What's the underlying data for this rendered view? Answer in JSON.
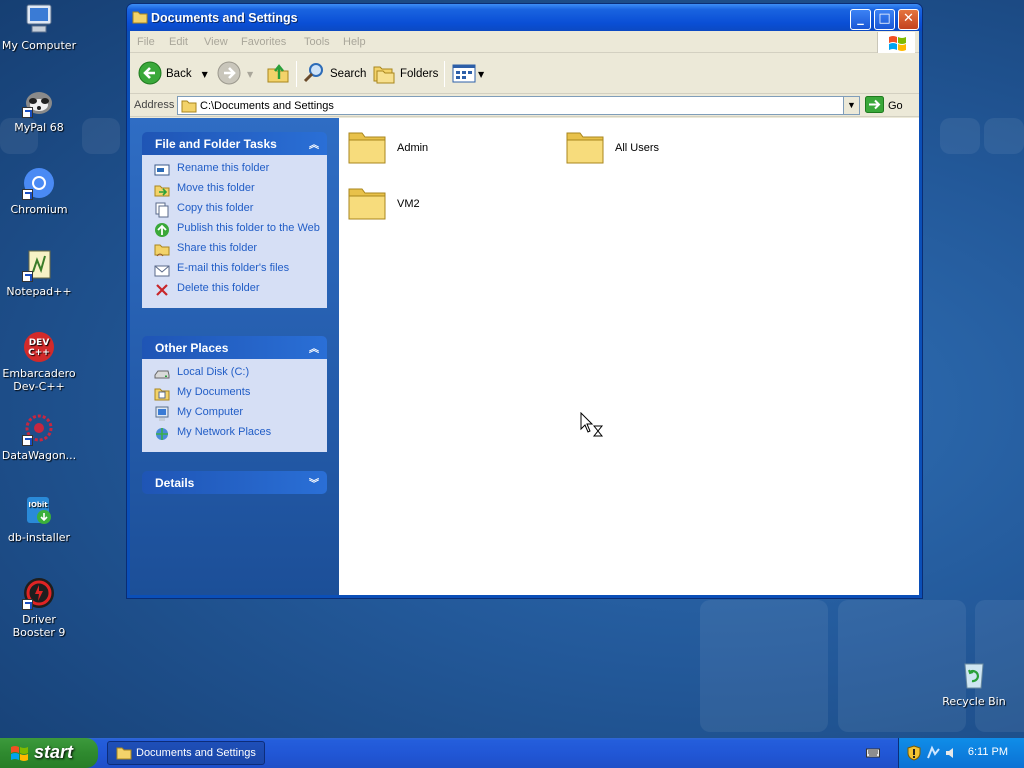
{
  "desktop": {
    "icons": [
      {
        "label": "My Computer",
        "icon": "my-computer-icon"
      },
      {
        "label": "MyPal 68",
        "icon": "mypal-icon"
      },
      {
        "label": "Chromium",
        "icon": "chromium-icon"
      },
      {
        "label": "Notepad++",
        "icon": "notepadpp-icon"
      },
      {
        "label": "Embarcadero Dev-C++",
        "icon": "devcpp-icon"
      },
      {
        "label": "DataWagon...",
        "icon": "datawagon-icon"
      },
      {
        "label": "db-installer",
        "icon": "db-installer-icon"
      },
      {
        "label": "Driver Booster 9",
        "icon": "driver-booster-icon"
      },
      {
        "label": "Recycle Bin",
        "icon": "recycle-bin-icon"
      }
    ]
  },
  "window": {
    "title": "Documents and Settings",
    "menu": [
      "File",
      "Edit",
      "View",
      "Favorites",
      "Tools",
      "Help"
    ],
    "toolbar": {
      "back": "Back",
      "search": "Search",
      "folders": "Folders"
    },
    "address": {
      "label": "Address",
      "value": "C:\\Documents and Settings",
      "go": "Go"
    },
    "task_panel": {
      "title": "File and Folder Tasks",
      "items": [
        "Rename this folder",
        "Move this folder",
        "Copy this folder",
        "Publish this folder to the Web",
        "Share this folder",
        "E-mail this folder's files",
        "Delete this folder"
      ]
    },
    "places_panel": {
      "title": "Other Places",
      "items": [
        "Local Disk (C:)",
        "My Documents",
        "My Computer",
        "My Network Places"
      ]
    },
    "details_panel": {
      "title": "Details"
    },
    "folders": [
      "Admin",
      "All Users",
      "VM2"
    ]
  },
  "taskbar": {
    "start": "start",
    "task": "Documents and Settings",
    "clock": "6:11 PM"
  },
  "colors": {
    "desktop": "#23599a",
    "taskbar": "#245edc",
    "start": "#2f8a2f",
    "link": "#215dc6"
  }
}
